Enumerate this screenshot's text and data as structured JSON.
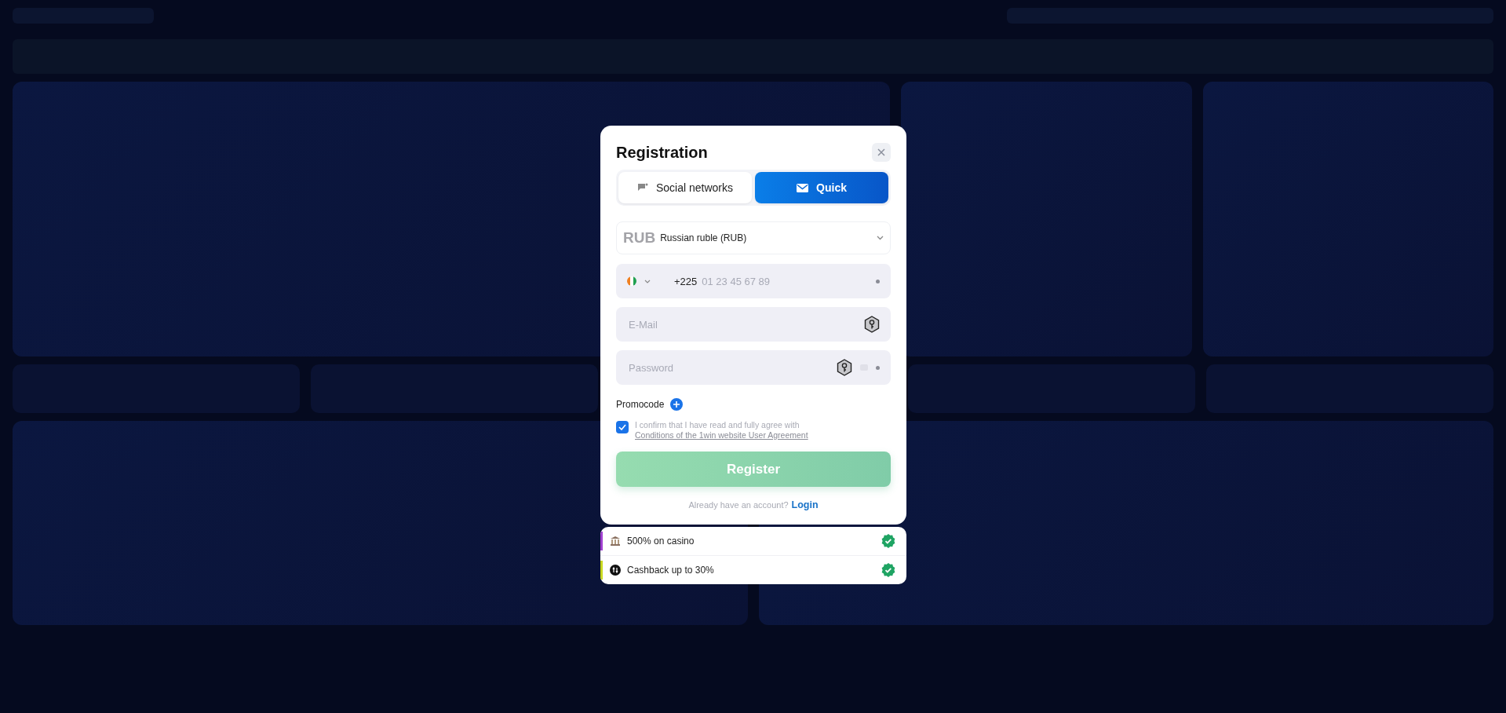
{
  "modal": {
    "title": "Registration",
    "tabs": [
      {
        "label": "Social networks",
        "selected": false,
        "kind": "chat"
      },
      {
        "label": "Quick",
        "selected": true,
        "kind": "mail"
      }
    ],
    "currency": {
      "code": "RUB",
      "name": "Russian ruble (RUB)"
    },
    "phone": {
      "dial_code": "+225",
      "placeholder": "01 23 45 67 89"
    },
    "email": {
      "placeholder": "E-Mail"
    },
    "password": {
      "placeholder": "Password"
    },
    "promocode": "Promocode",
    "agreement": {
      "checked": true,
      "text": "I confirm that I have read and fully agree with",
      "link": "Conditions of the 1win website User Agreement"
    },
    "register": "Register",
    "login": {
      "prompt": "Already have an account?",
      "link": "Login"
    }
  },
  "bonuses": [
    {
      "label": "500% on casino",
      "color": "#a040d0",
      "kind": "bank"
    },
    {
      "label": "Cashback up to 30%",
      "color": "#c8d820",
      "kind": "cashback"
    }
  ]
}
